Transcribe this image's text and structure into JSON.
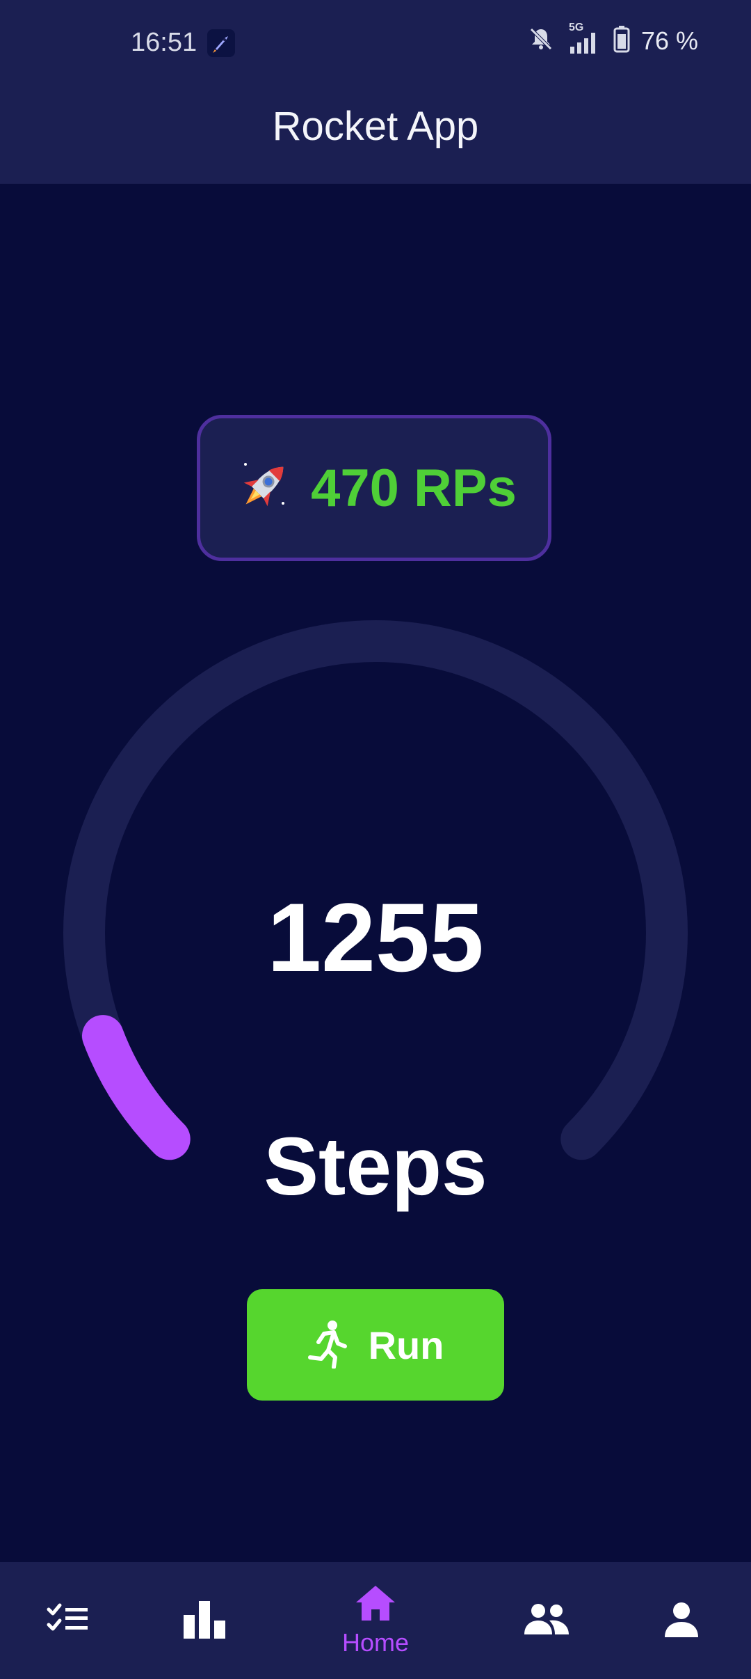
{
  "status_bar": {
    "time": "16:51",
    "network": "5G",
    "battery": "76 %"
  },
  "app": {
    "title": "Rocket App"
  },
  "rp_badge": {
    "icon": "rocket",
    "text": "470 RPs"
  },
  "steps": {
    "count": "1255",
    "label": "Steps",
    "progress_fraction": 0.09
  },
  "run_button": {
    "icon": "running-person",
    "label": "Run"
  },
  "bottom_nav": {
    "items": [
      {
        "icon": "checklist-icon",
        "label": ""
      },
      {
        "icon": "bar-chart-icon",
        "label": ""
      },
      {
        "icon": "home-icon",
        "label": "Home",
        "active": true
      },
      {
        "icon": "group-icon",
        "label": ""
      },
      {
        "icon": "person-icon",
        "label": ""
      }
    ]
  },
  "colors": {
    "background": "#080c3a",
    "bar": "#1b1f52",
    "accent_purple": "#b64dff",
    "accent_green": "#56d62e",
    "rp_green": "#4fcf37",
    "track": "#1b1f52"
  }
}
